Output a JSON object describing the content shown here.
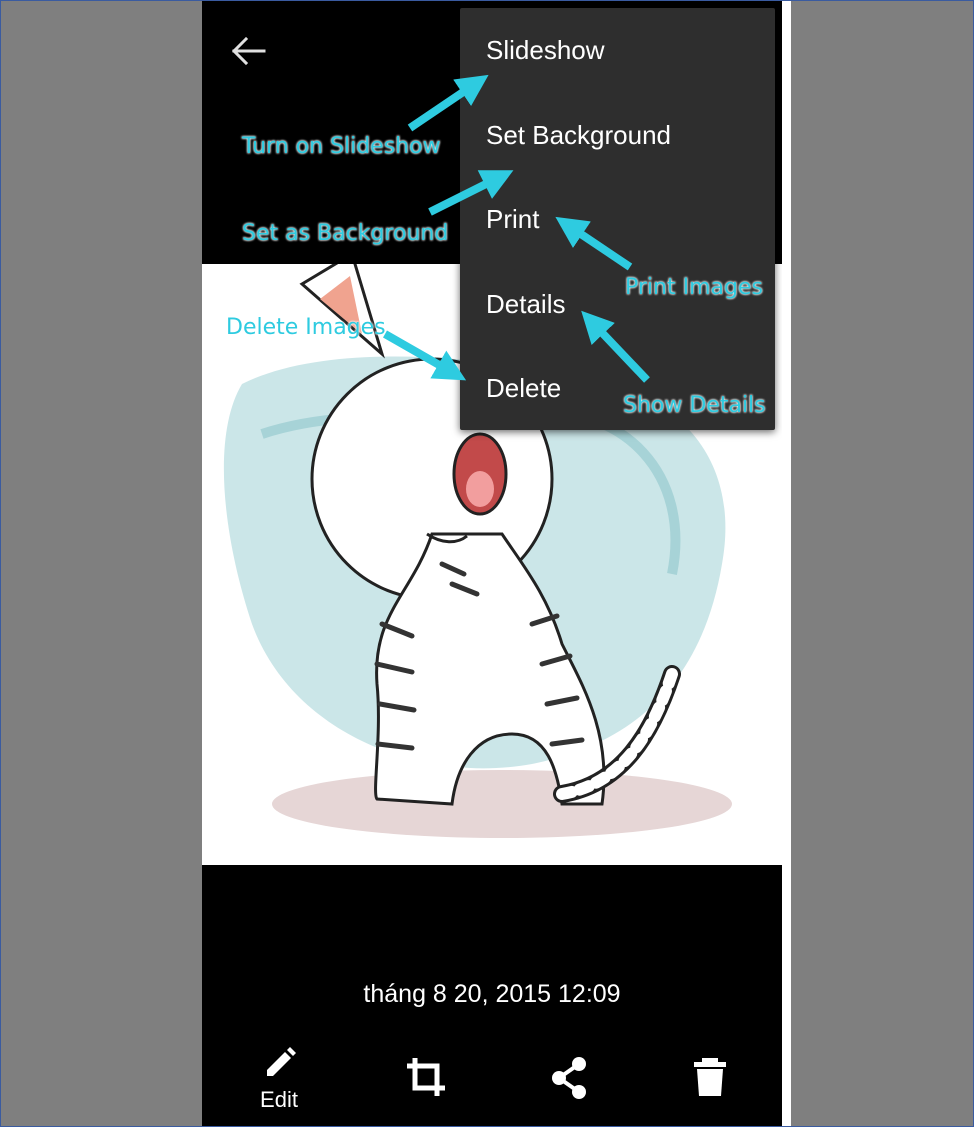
{
  "header": {
    "back_icon": "arrow-left-icon"
  },
  "menu": {
    "items": [
      {
        "label": "Slideshow"
      },
      {
        "label": "Set Background"
      },
      {
        "label": "Print"
      },
      {
        "label": "Details"
      },
      {
        "label": "Delete"
      }
    ]
  },
  "annotations": {
    "slideshow": "Turn on Slideshow",
    "background": "Set as Background",
    "print": "Print Images",
    "delete": "Delete Images",
    "details": "Show Details"
  },
  "photo": {
    "subject": "cat-illustration"
  },
  "timestamp": "tháng 8 20, 2015 12:09",
  "toolbar": {
    "edit_label": "Edit",
    "icons": [
      "pencil-icon",
      "crop-icon",
      "share-icon",
      "trash-icon"
    ]
  },
  "colors": {
    "annotation": "#2ecbe0",
    "menu_bg": "#2e2e2e",
    "screen_bg": "#000000",
    "page_bg": "#7f7f7f"
  }
}
